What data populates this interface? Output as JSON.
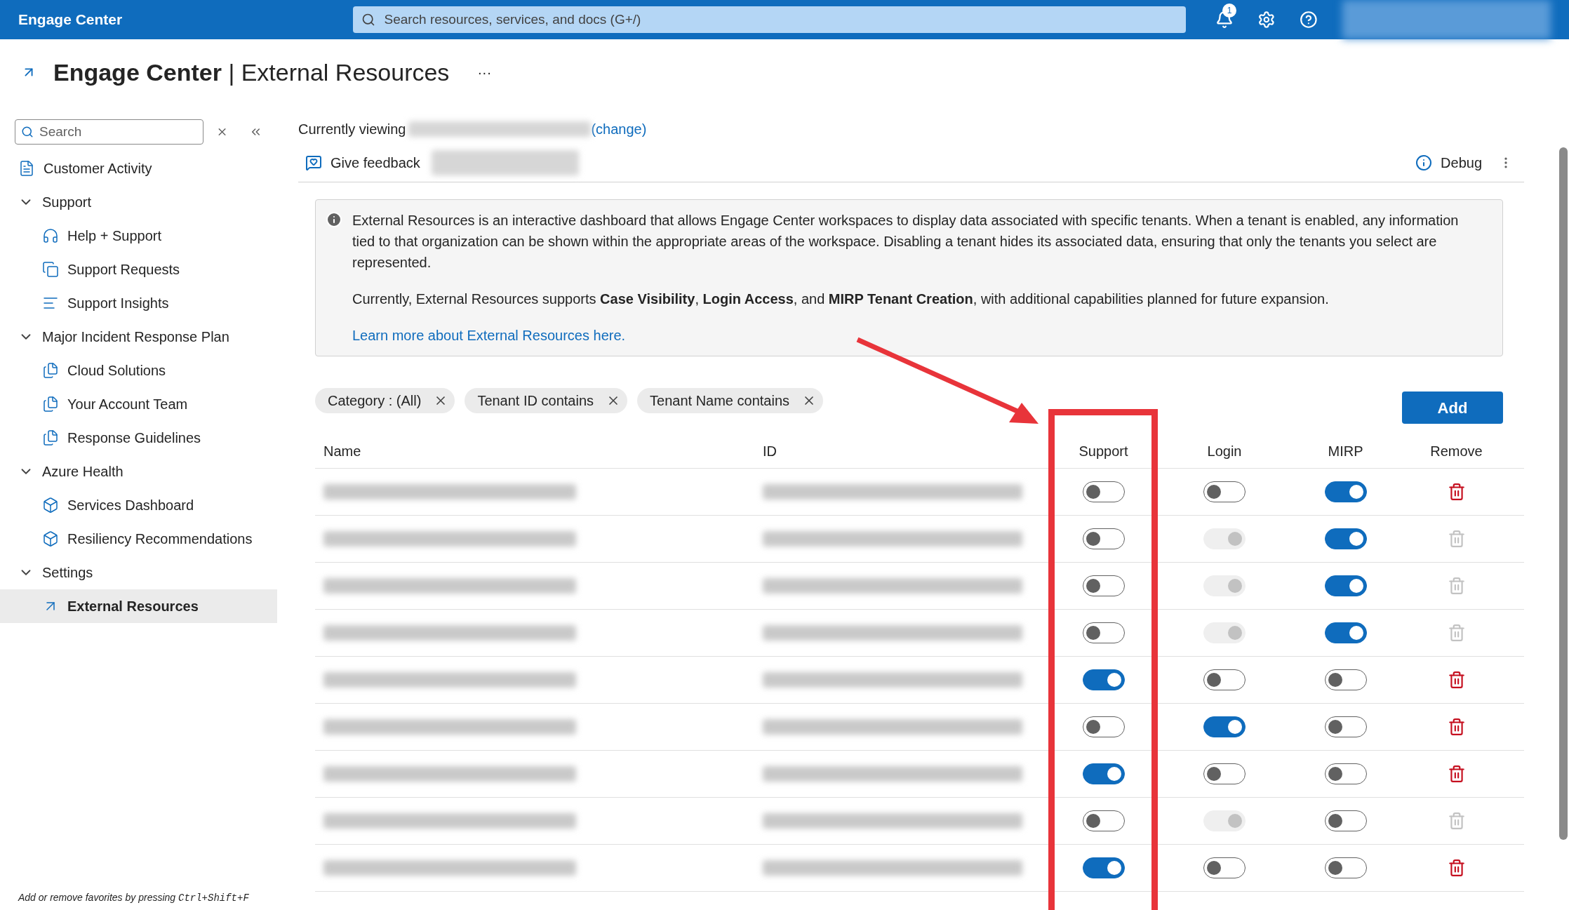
{
  "top_bar": {
    "brand": "Engage Center",
    "search_placeholder": "Search resources, services, and docs (G+/)",
    "notification_count": "1"
  },
  "page_title": {
    "bold": "Engage Center",
    "rest": "| External Resources",
    "more": "···"
  },
  "sidebar": {
    "search_placeholder": "Search",
    "items": [
      {
        "label": "Customer Activity",
        "selected": false
      },
      {
        "label": "Support",
        "expanded": true,
        "selected": false,
        "children": [
          {
            "label": "Help + Support",
            "selected": false
          },
          {
            "label": "Support Requests",
            "selected": false
          },
          {
            "label": "Support Insights",
            "selected": false
          }
        ]
      },
      {
        "label": "Major Incident Response Plan",
        "expanded": true,
        "selected": false,
        "children": [
          {
            "label": "Cloud Solutions",
            "selected": false
          },
          {
            "label": "Your Account Team",
            "selected": false
          },
          {
            "label": "Response Guidelines",
            "selected": false
          }
        ]
      },
      {
        "label": "Azure Health",
        "expanded": true,
        "selected": false,
        "children": [
          {
            "label": "Services Dashboard",
            "selected": false
          },
          {
            "label": "Resiliency Recommendations",
            "selected": false
          }
        ]
      },
      {
        "label": "Settings",
        "expanded": true,
        "selected": false,
        "children": [
          {
            "label": "External Resources",
            "selected": true
          }
        ]
      }
    ],
    "footer_text": "Add or remove favorites by pressing ",
    "footer_keys": "Ctrl+Shift+F"
  },
  "viewing": {
    "label": "Currently viewing",
    "link": "(change)"
  },
  "toolbar": {
    "feedback": "Give feedback",
    "debug": "Debug"
  },
  "info": {
    "paragraphs": [
      "External Resources is an interactive dashboard that allows Engage Center workspaces to display data associated with specific tenants. When a tenant is enabled, any information tied to that organization can be shown within the appropriate areas of the workspace. Disabling a tenant hides its associated data, ensuring that only the tenants you select are represented.",
      "Currently, External Resources supports **Case Visibility**, **Login Access**, and **MIRP Tenant Creation**, with additional capabilities planned for future expansion."
    ],
    "link": "Learn more about External Resources here."
  },
  "filters": [
    "Category : (All)",
    "Tenant ID contains",
    "Tenant Name contains"
  ],
  "add_button": "Add",
  "table": {
    "columns": [
      "Name",
      "ID",
      "Support",
      "Login",
      "MIRP",
      "Remove"
    ],
    "rows": [
      {
        "support": false,
        "login": false,
        "login_disabled": false,
        "mirp": true,
        "remove_disabled": false
      },
      {
        "support": false,
        "login": true,
        "login_disabled": true,
        "mirp": true,
        "remove_disabled": true
      },
      {
        "support": false,
        "login": true,
        "login_disabled": true,
        "mirp": true,
        "remove_disabled": true
      },
      {
        "support": false,
        "login": true,
        "login_disabled": true,
        "mirp": true,
        "remove_disabled": true
      },
      {
        "support": true,
        "login": false,
        "login_disabled": false,
        "mirp": false,
        "remove_disabled": false
      },
      {
        "support": false,
        "login": true,
        "login_disabled": false,
        "mirp": false,
        "remove_disabled": false
      },
      {
        "support": true,
        "login": false,
        "login_disabled": false,
        "mirp": false,
        "remove_disabled": false
      },
      {
        "support": false,
        "login": true,
        "login_disabled": true,
        "mirp": false,
        "remove_disabled": true
      },
      {
        "support": true,
        "login": false,
        "login_disabled": false,
        "mirp": false,
        "remove_disabled": false
      }
    ]
  }
}
